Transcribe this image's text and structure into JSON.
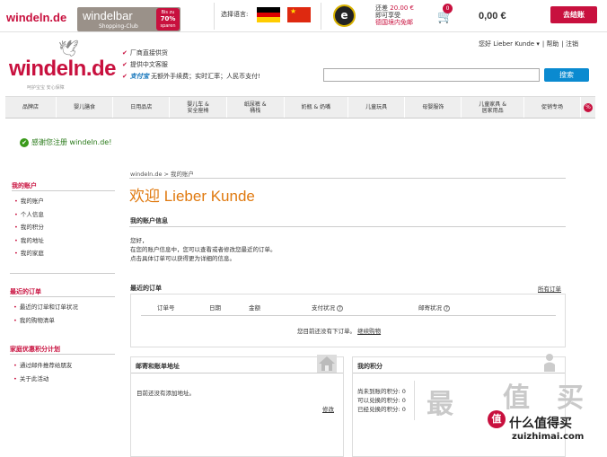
{
  "topbar": {
    "brand": "windeln.de",
    "windelbar_title": "windelbar",
    "windelbar_sub": "Shopping-Club",
    "discount_top": "Bis zu",
    "discount_pct": "70%",
    "discount_bot": "sparen",
    "language_label": "选择语言:",
    "ship_line1_pre": "还差 ",
    "ship_amount": "20.00 €",
    "ship_line2": "即可享受",
    "ship_line3": "德国境内免邮",
    "cart_count": "0",
    "cart_total": "0,00 €",
    "checkout": "去结账",
    "trust_label": "e"
  },
  "header": {
    "logo": "windeln.de",
    "tagline": "呵护宝宝 安心保障",
    "bullets": [
      "厂商直接供货",
      "提供中文客服"
    ],
    "alipay": "支付宝",
    "alipay_text": "无额外手续费；实时汇率；人民币支付!",
    "user_greeting": "您好 Lieber Kunde ▾",
    "help": "帮助",
    "logout": "注销",
    "search_placeholder": "",
    "search_button": "搜索"
  },
  "nav": [
    "品牌店",
    "婴儿膳食",
    "日用品店",
    "婴儿车 &\n安全座椅",
    "纸尿裤 &\n桶栈",
    "奶瓶 & 奶嘴",
    "儿童玩具",
    "母婴服饰",
    "儿童家具 &\n居家用品",
    "促销专场"
  ],
  "nav_pct": "%",
  "success_msg": "感谢您注册 windeln.de!",
  "sidebar": {
    "account_title": "我的账户",
    "account_items": [
      "我的账户",
      "个人信息",
      "我的积分",
      "我的地址",
      "我的家庭"
    ],
    "orders_title": "最近的订单",
    "orders_items": [
      "最近的订单和订单状况",
      "我的购物清单"
    ],
    "points_title": "家庭优惠积分计划",
    "points_items": [
      "通过邮件推荐给朋友",
      "关于此活动"
    ]
  },
  "main": {
    "breadcrumb": "windeln.de > 我的账户",
    "welcome": "欢迎 Lieber Kunde",
    "info_title": "我的账户信息",
    "hello": "您好，",
    "info_line1": "在您的账户信息中，您可以查看或者修改您最近的订单。",
    "info_line2": "点击具体订单可以获得更为详细的信息。",
    "orders_title": "最近的订单",
    "all_orders": "所有订单",
    "col_order_no": "订单号",
    "col_date": "日期",
    "col_amount": "金额",
    "col_pay": "支付状况",
    "col_ship": "邮寄状况",
    "q": "?",
    "no_orders": "您目前还没有下订单。",
    "continue_shopping": "继续购物",
    "addr_title": "邮寄和账单地址",
    "addr_empty": "目前还没有添加地址。",
    "modify": "修改",
    "points_title": "我的积分",
    "pts_line1": "尚未到账的积分: 0",
    "pts_line2": "可以兑换的积分: 0",
    "pts_line3": "已经兑换的积分: 0"
  },
  "watermark": {
    "big1": "最",
    "big2": "值",
    "big3": "买",
    "logo": "值",
    "title": "什么值得买",
    "url": "zuizhimai.com"
  }
}
